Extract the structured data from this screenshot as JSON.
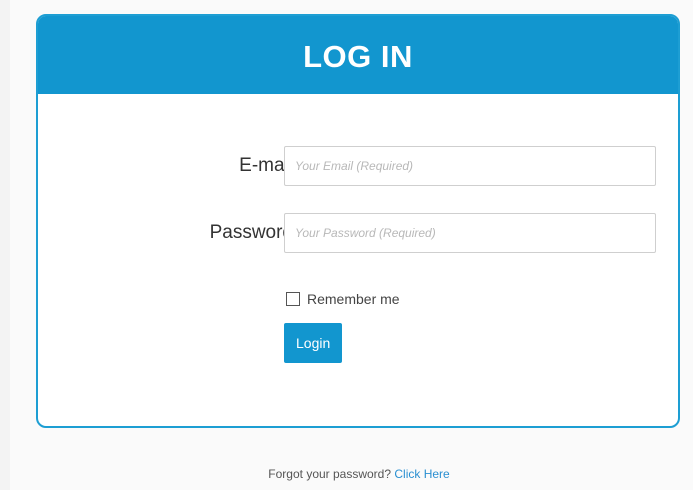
{
  "login": {
    "title": "LOG IN",
    "email_label": "E-mail",
    "email_placeholder": "Your Email (Required)",
    "email_value": "",
    "password_label": "Password",
    "password_placeholder": "Your Password (Required)",
    "password_value": "",
    "remember_label": "Remember me",
    "remember_checked": false,
    "submit_label": "Login"
  },
  "footer": {
    "prompt": "Forgot your password? ",
    "link_label": "Click Here"
  },
  "colors": {
    "accent": "#1296cf",
    "border": "#1d9ed3",
    "link": "#2a8fd1"
  }
}
